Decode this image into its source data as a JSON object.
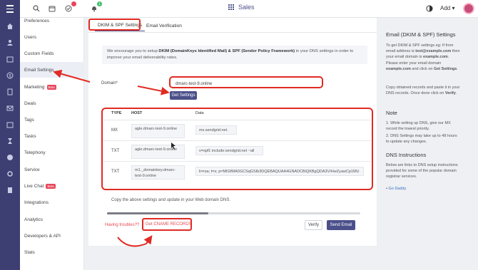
{
  "topbar": {
    "app_name": "Sales",
    "add_label": "Add",
    "notification_count": "1"
  },
  "menu": {
    "items": [
      {
        "label": "Preferences"
      },
      {
        "label": "Users"
      },
      {
        "label": "Custom Fields"
      },
      {
        "label": "Email Settings"
      },
      {
        "label": "Marketing",
        "badge": "Beta"
      },
      {
        "label": "Deals"
      },
      {
        "label": "Tags"
      },
      {
        "label": "Tasks"
      },
      {
        "label": "Telephony"
      },
      {
        "label": "Service"
      },
      {
        "label": "Live Chat",
        "badge": "Beta"
      },
      {
        "label": "Integrations"
      },
      {
        "label": "Analytics"
      },
      {
        "label": "Developers & API"
      },
      {
        "label": "Stats"
      }
    ]
  },
  "tabs": [
    {
      "label": "DKIM & SPF Settings"
    },
    {
      "label": "Email Verification"
    }
  ],
  "info": {
    "pre": "We encourage you to setup ",
    "bold": "DKIM (DomainKeys Identified Mail) & SPF (Sender Policy Framework)",
    "post": " in your DNS settings in order to improve your email deliverability rates."
  },
  "form": {
    "domain_label": "Domain*",
    "domain_value": "dmarc-test-9.online",
    "get_settings": "Get Settings"
  },
  "dns": {
    "headers": {
      "type": "TYPE",
      "host": "HOST",
      "data": "Data"
    },
    "records": [
      {
        "type": "MX",
        "host": "agle.dmarc-test-9.online",
        "data": "mx.sendgrid.net."
      },
      {
        "type": "TXT",
        "host": "agle.dmarc-test-9.online",
        "data": "v=spf1 include:sendgrid.net ~all"
      },
      {
        "type": "TXT",
        "host": "m1._domainkey.dmarc-test-9.online",
        "data": "k=rsa; t=s; p=MIGfMA0GCSqGSIb3DQEBAQUAA4GNADCBiQKBgQDA3V/HwZyawCp1MU"
      }
    ]
  },
  "copy_note": "Copy the above settings and update in your Web domain DNS.",
  "scroll_fraction": 0.4,
  "footer": {
    "trouble": "Having troubles??",
    "cname": "Get CNAME RECORDS",
    "verify": "Verify",
    "send_email": "Send Email"
  },
  "help": {
    "title": "Email (DKIM & SPF) Settings",
    "para1_a": "To get DKIM & SPF settings eg: If from email address is ",
    "para1_b": "test@example.com",
    "para1_c": " then your email domain is ",
    "para1_d": "example.com",
    "para1_e": ". Please enter your email domain ",
    "para1_f": "example.com",
    "para1_g": " and click on ",
    "para1_h": "Get Settings",
    "para1_i": ".",
    "para2_a": "Copy obtained records and paste it in your DNS records. Once done click on ",
    "para2_b": "Verify",
    "para2_c": ".",
    "note_title": "Note",
    "note1": "1. While setting up DNS, give our MX record the lowest priority.",
    "note2": "2. DNS Settings may take up to 48 hours to update any changes.",
    "dns_title": "DNS Instructions",
    "dns_text": "Below are links to DNS setup instructions provided for some of the popular domain registrar services.",
    "link": "Go Daddy"
  },
  "colors": {
    "rail": "#3d3f72",
    "primary": "#4b4f8a",
    "annotation": "#e02b23",
    "danger_text": "#e64a50"
  }
}
